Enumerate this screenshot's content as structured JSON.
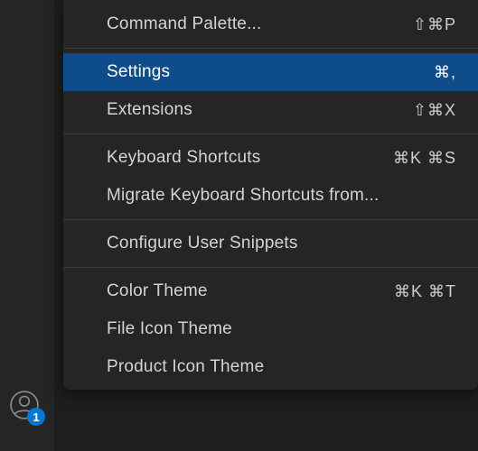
{
  "menu": {
    "items": [
      {
        "label": "Command Palette...",
        "shortcut": "⇧⌘P"
      }
    ],
    "settings_group": [
      {
        "label": "Settings",
        "shortcut": "⌘,",
        "selected": true
      },
      {
        "label": "Extensions",
        "shortcut": "⇧⌘X"
      }
    ],
    "keyboard_group": [
      {
        "label": "Keyboard Shortcuts",
        "shortcut": "⌘K ⌘S"
      },
      {
        "label": "Migrate Keyboard Shortcuts from..."
      }
    ],
    "snippets_group": [
      {
        "label": "Configure User Snippets"
      }
    ],
    "theme_group": [
      {
        "label": "Color Theme",
        "shortcut": "⌘K ⌘T"
      },
      {
        "label": "File Icon Theme"
      },
      {
        "label": "Product Icon Theme"
      }
    ]
  },
  "sidebar": {
    "account_badge": "1"
  }
}
